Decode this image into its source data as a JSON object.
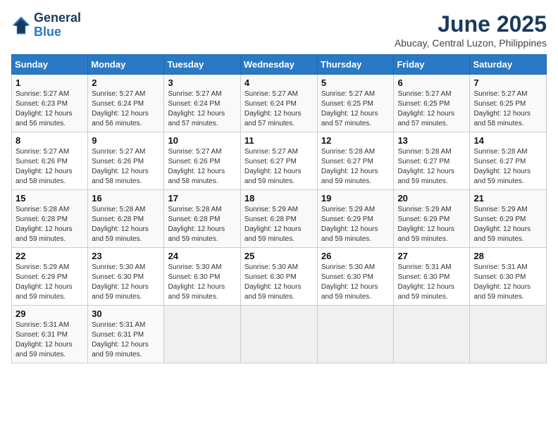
{
  "logo": {
    "line1": "General",
    "line2": "Blue"
  },
  "title": "June 2025",
  "subtitle": "Abucay, Central Luzon, Philippines",
  "weekdays": [
    "Sunday",
    "Monday",
    "Tuesday",
    "Wednesday",
    "Thursday",
    "Friday",
    "Saturday"
  ],
  "weeks": [
    [
      {
        "day": "1",
        "sunrise": "5:27 AM",
        "sunset": "6:23 PM",
        "daylight": "12 hours and 56 minutes."
      },
      {
        "day": "2",
        "sunrise": "5:27 AM",
        "sunset": "6:24 PM",
        "daylight": "12 hours and 56 minutes."
      },
      {
        "day": "3",
        "sunrise": "5:27 AM",
        "sunset": "6:24 PM",
        "daylight": "12 hours and 57 minutes."
      },
      {
        "day": "4",
        "sunrise": "5:27 AM",
        "sunset": "6:24 PM",
        "daylight": "12 hours and 57 minutes."
      },
      {
        "day": "5",
        "sunrise": "5:27 AM",
        "sunset": "6:25 PM",
        "daylight": "12 hours and 57 minutes."
      },
      {
        "day": "6",
        "sunrise": "5:27 AM",
        "sunset": "6:25 PM",
        "daylight": "12 hours and 57 minutes."
      },
      {
        "day": "7",
        "sunrise": "5:27 AM",
        "sunset": "6:25 PM",
        "daylight": "12 hours and 58 minutes."
      }
    ],
    [
      {
        "day": "8",
        "sunrise": "5:27 AM",
        "sunset": "6:26 PM",
        "daylight": "12 hours and 58 minutes."
      },
      {
        "day": "9",
        "sunrise": "5:27 AM",
        "sunset": "6:26 PM",
        "daylight": "12 hours and 58 minutes."
      },
      {
        "day": "10",
        "sunrise": "5:27 AM",
        "sunset": "6:26 PM",
        "daylight": "12 hours and 58 minutes."
      },
      {
        "day": "11",
        "sunrise": "5:27 AM",
        "sunset": "6:27 PM",
        "daylight": "12 hours and 59 minutes."
      },
      {
        "day": "12",
        "sunrise": "5:28 AM",
        "sunset": "6:27 PM",
        "daylight": "12 hours and 59 minutes."
      },
      {
        "day": "13",
        "sunrise": "5:28 AM",
        "sunset": "6:27 PM",
        "daylight": "12 hours and 59 minutes."
      },
      {
        "day": "14",
        "sunrise": "5:28 AM",
        "sunset": "6:27 PM",
        "daylight": "12 hours and 59 minutes."
      }
    ],
    [
      {
        "day": "15",
        "sunrise": "5:28 AM",
        "sunset": "6:28 PM",
        "daylight": "12 hours and 59 minutes."
      },
      {
        "day": "16",
        "sunrise": "5:28 AM",
        "sunset": "6:28 PM",
        "daylight": "12 hours and 59 minutes."
      },
      {
        "day": "17",
        "sunrise": "5:28 AM",
        "sunset": "6:28 PM",
        "daylight": "12 hours and 59 minutes."
      },
      {
        "day": "18",
        "sunrise": "5:29 AM",
        "sunset": "6:28 PM",
        "daylight": "12 hours and 59 minutes."
      },
      {
        "day": "19",
        "sunrise": "5:29 AM",
        "sunset": "6:29 PM",
        "daylight": "12 hours and 59 minutes."
      },
      {
        "day": "20",
        "sunrise": "5:29 AM",
        "sunset": "6:29 PM",
        "daylight": "12 hours and 59 minutes."
      },
      {
        "day": "21",
        "sunrise": "5:29 AM",
        "sunset": "6:29 PM",
        "daylight": "12 hours and 59 minutes."
      }
    ],
    [
      {
        "day": "22",
        "sunrise": "5:29 AM",
        "sunset": "6:29 PM",
        "daylight": "12 hours and 59 minutes."
      },
      {
        "day": "23",
        "sunrise": "5:30 AM",
        "sunset": "6:30 PM",
        "daylight": "12 hours and 59 minutes."
      },
      {
        "day": "24",
        "sunrise": "5:30 AM",
        "sunset": "6:30 PM",
        "daylight": "12 hours and 59 minutes."
      },
      {
        "day": "25",
        "sunrise": "5:30 AM",
        "sunset": "6:30 PM",
        "daylight": "12 hours and 59 minutes."
      },
      {
        "day": "26",
        "sunrise": "5:30 AM",
        "sunset": "6:30 PM",
        "daylight": "12 hours and 59 minutes."
      },
      {
        "day": "27",
        "sunrise": "5:31 AM",
        "sunset": "6:30 PM",
        "daylight": "12 hours and 59 minutes."
      },
      {
        "day": "28",
        "sunrise": "5:31 AM",
        "sunset": "6:30 PM",
        "daylight": "12 hours and 59 minutes."
      }
    ],
    [
      {
        "day": "29",
        "sunrise": "5:31 AM",
        "sunset": "6:31 PM",
        "daylight": "12 hours and 59 minutes."
      },
      {
        "day": "30",
        "sunrise": "5:31 AM",
        "sunset": "6:31 PM",
        "daylight": "12 hours and 59 minutes."
      },
      null,
      null,
      null,
      null,
      null
    ]
  ]
}
